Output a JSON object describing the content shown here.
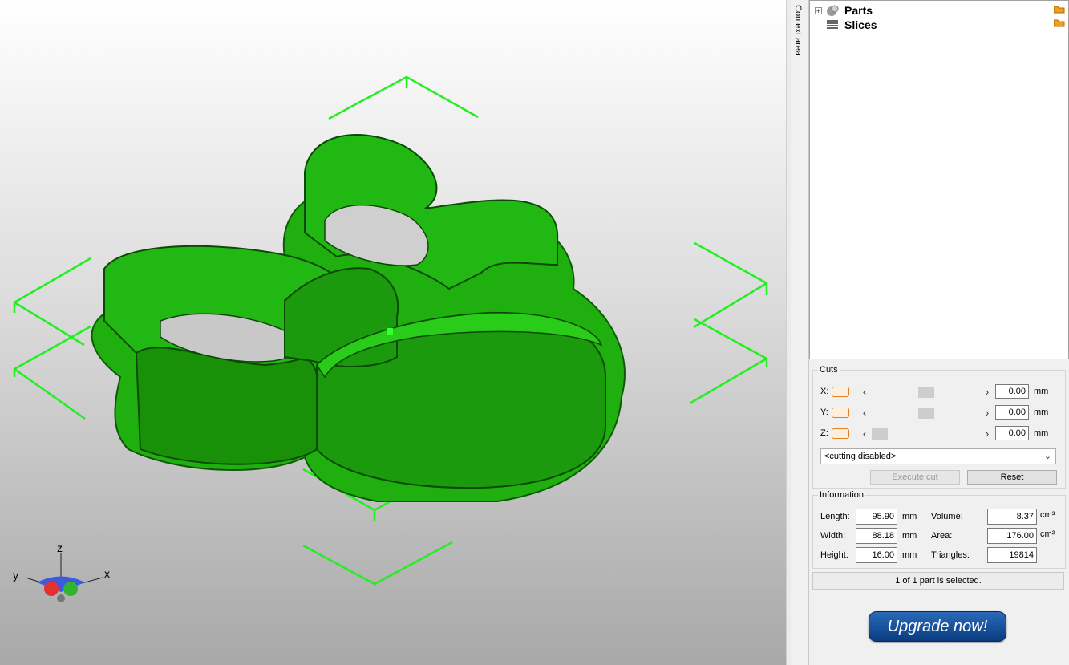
{
  "viewport": {
    "axis_labels": {
      "x": "x",
      "y": "y",
      "z": "z"
    },
    "model_color": "#1faa10"
  },
  "context_tab": {
    "label": "Context area"
  },
  "tree": {
    "items": [
      {
        "label": "Parts",
        "icon": "parts-icon",
        "expandable": true
      },
      {
        "label": "Slices",
        "icon": "slices-icon",
        "expandable": false
      }
    ]
  },
  "cuts": {
    "title": "Cuts",
    "axes": [
      {
        "label": "X:",
        "value": "0.00",
        "unit": "mm",
        "position": 0.5
      },
      {
        "label": "Y:",
        "value": "0.00",
        "unit": "mm",
        "position": 0.5
      },
      {
        "label": "Z:",
        "value": "0.00",
        "unit": "mm",
        "position": 0.0
      }
    ],
    "mode": "<cutting disabled>",
    "execute_label": "Execute cut",
    "reset_label": "Reset"
  },
  "information": {
    "title": "Information",
    "length_label": "Length:",
    "length_value": "95.90",
    "length_unit": "mm",
    "width_label": "Width:",
    "width_value": "88.18",
    "width_unit": "mm",
    "height_label": "Height:",
    "height_value": "16.00",
    "height_unit": "mm",
    "volume_label": "Volume:",
    "volume_value": "8.37",
    "volume_unit": "cm³",
    "area_label": "Area:",
    "area_value": "176.00",
    "area_unit": "cm²",
    "triangles_label": "Triangles:",
    "triangles_value": "19814"
  },
  "status": {
    "text": "1 of 1 part is selected."
  },
  "upgrade": {
    "label": "Upgrade now!"
  }
}
